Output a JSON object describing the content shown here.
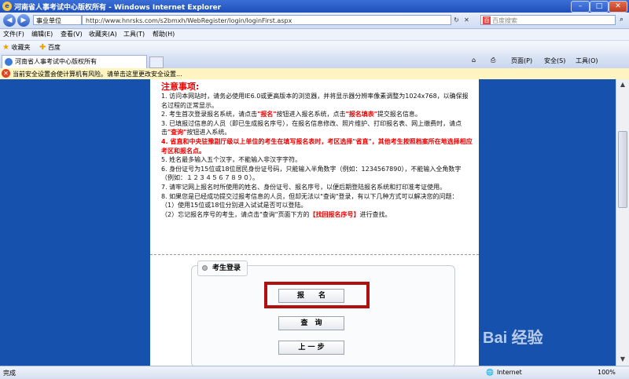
{
  "window": {
    "title": "河南省人事考试中心版权所有 - Windows Internet Explorer"
  },
  "address_bar": {
    "category": "事业单位",
    "url": "http://www.hnrsks.com/s2bmxh/WebRegister/login/loginFirst.aspx",
    "search_placeholder": "百度搜索"
  },
  "menu": [
    "文件(F)",
    "编辑(E)",
    "查看(V)",
    "收藏夹(A)",
    "工具(T)",
    "帮助(H)"
  ],
  "favorites": {
    "label": "收藏夹",
    "item": "百度"
  },
  "tab": {
    "label": "河南省人事考试中心版权所有"
  },
  "command_bar": {
    "page": "页面(P)",
    "safety": "安全(S)",
    "tools": "工具(O)"
  },
  "infobar": {
    "text": "当前安全设置会使计算机有风险。请单击这里更改安全设置..."
  },
  "notice": {
    "title": "注意事项:",
    "n1": "1. 访问本网站时，请务必使用IE6.0或更高版本的浏览器，并将显示器分辨率像素调整为1024x768，以确保报名过程的正常显示。",
    "n2a": "2. 考生首次登录报名系统，请点击",
    "n2b": "\"报名\"",
    "n2c": "按钮进入报名系统，点击",
    "n2d": "\"报名填表\"",
    "n2e": "提交报名信息。",
    "n3a": "3. 已填报过信息的人员（即已生成报名序号），在报名信息修改、照片维护、打印报名表、网上缴费时，请点击",
    "n3b": "\"查询\"",
    "n3c": "按钮进入系统。",
    "n4": "4. 省直和中央驻豫副厅级以上单位的考生在填写报名表时，考区选择\"省直\"，其他考生按照档案所在地选择相应考区和报名点。",
    "n5": "5. 姓名最多输入五个汉字，不能输入非汉字字符。",
    "n6": "6. 身份证号为15位或18位居民身份证号码，只能输入半角数字（例如：1234567890），不能输入全角数字（例如：１２３４５６７８９０）。",
    "n7": "7. 请牢记网上报名时所使用的姓名、身份证号、报名序号，以便后期登陆报名系统和打印准考证使用。",
    "n8": "8. 如果您是已经成功提交过报考信息的人员，但却无法以\"查询\"登录，有以下几种方式可以解决您的问题：",
    "n8a": "（1）使用15位或18位分别进入试试是否可以登陆。",
    "n8b_pre": "（2）忘记报名序号的考生，请点击\"查询\"页面下方的",
    "n8b_red": "【找回报名序号】",
    "n8b_post": "进行查找。"
  },
  "login": {
    "legend": "考生登录",
    "btn_signup": "报　　名",
    "btn_query": "查　询",
    "btn_back": "上 一 步"
  },
  "status": {
    "left": "完成",
    "zone": "Internet",
    "zoom": "100%"
  },
  "watermark": "Bai 经验"
}
